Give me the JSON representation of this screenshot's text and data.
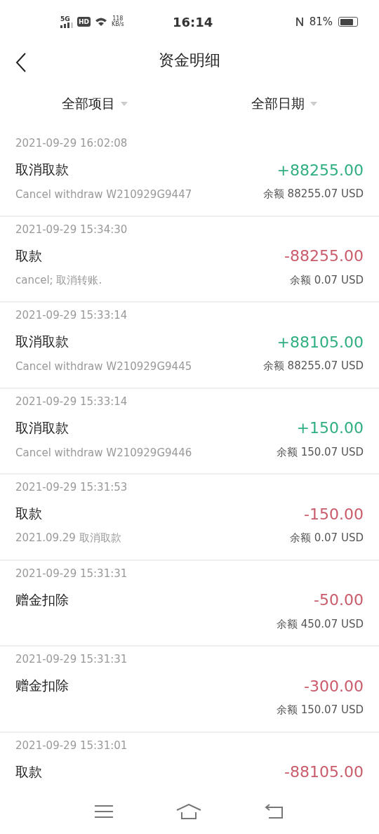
{
  "status_bar": {
    "network": "5G",
    "hd": "HD",
    "speed": "118",
    "speed_unit": "KB/s",
    "time": "16:14",
    "battery": "81%"
  },
  "header": {
    "title": "资金明细"
  },
  "filters": [
    {
      "label": "全部项目"
    },
    {
      "label": "全部日期"
    }
  ],
  "transactions": [
    {
      "time": "2021-09-29 16:02:08",
      "title": "取消取款",
      "note": "Cancel withdraw W210929G9447",
      "amount": "+88255.00",
      "kind": "credit",
      "balance": "余额 88255.07 USD"
    },
    {
      "time": "2021-09-29 15:34:30",
      "title": "取款",
      "note": "cancel; 取消转账.",
      "amount": "-88255.00",
      "kind": "debit",
      "balance": "余额 0.07 USD"
    },
    {
      "time": "2021-09-29 15:33:14",
      "title": "取消取款",
      "note": "Cancel withdraw W210929G9445",
      "amount": "+88105.00",
      "kind": "credit",
      "balance": "余额 88255.07 USD"
    },
    {
      "time": "2021-09-29 15:33:14",
      "title": "取消取款",
      "note": "Cancel withdraw W210929G9446",
      "amount": "+150.00",
      "kind": "credit",
      "balance": "余额 150.07 USD"
    },
    {
      "time": "2021-09-29 15:31:53",
      "title": "取款",
      "note": "2021.09.29 取消取款",
      "amount": "-150.00",
      "kind": "debit",
      "balance": "余额 0.07 USD"
    },
    {
      "time": "2021-09-29 15:31:31",
      "title": "赠金扣除",
      "amount": "-50.00",
      "kind": "debit",
      "balance": "余额 450.07 USD"
    },
    {
      "time": "2021-09-29 15:31:31",
      "title": "赠金扣除",
      "amount": "-300.00",
      "kind": "debit",
      "balance": "余额 150.07 USD"
    },
    {
      "time": "2021-09-29 15:31:01",
      "title": "取款",
      "amount": "-88105.00",
      "kind": "debit"
    }
  ]
}
